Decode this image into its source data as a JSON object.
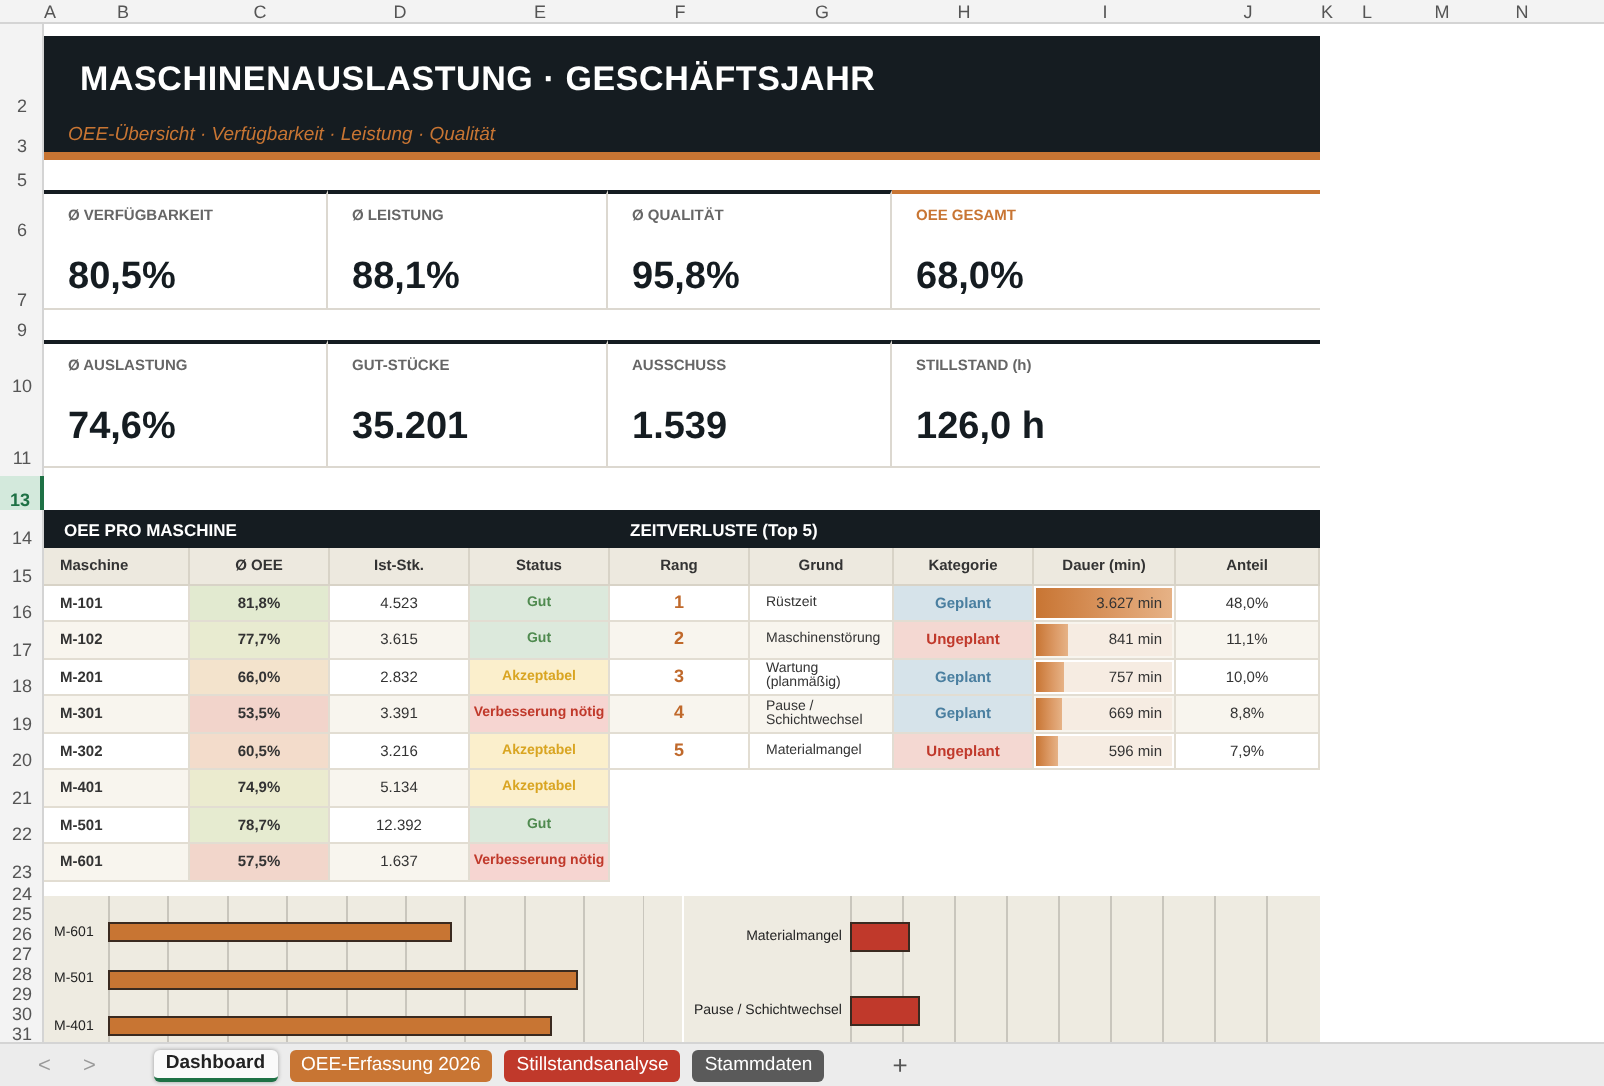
{
  "column_headers": [
    "A",
    "B",
    "C",
    "D",
    "E",
    "F",
    "G",
    "H",
    "I",
    "J",
    "K",
    "L",
    "M",
    "N"
  ],
  "row_headers": [
    {
      "label": "2",
      "selected": false
    },
    {
      "label": "3",
      "selected": false
    },
    {
      "label": "5",
      "selected": false
    },
    {
      "label": "6",
      "selected": false
    },
    {
      "label": "7",
      "selected": false
    },
    {
      "label": "9",
      "selected": false
    },
    {
      "label": "10",
      "selected": false
    },
    {
      "label": "11",
      "selected": false
    },
    {
      "label": "13",
      "selected": true
    },
    {
      "label": "14",
      "selected": false
    },
    {
      "label": "15",
      "selected": false
    },
    {
      "label": "16",
      "selected": false
    },
    {
      "label": "17",
      "selected": false
    },
    {
      "label": "18",
      "selected": false
    },
    {
      "label": "19",
      "selected": false
    },
    {
      "label": "20",
      "selected": false
    },
    {
      "label": "21",
      "selected": false
    },
    {
      "label": "22",
      "selected": false
    },
    {
      "label": "23",
      "selected": false
    },
    {
      "label": "24",
      "selected": false
    },
    {
      "label": "25",
      "selected": false
    },
    {
      "label": "26",
      "selected": false
    },
    {
      "label": "27",
      "selected": false
    },
    {
      "label": "28",
      "selected": false
    },
    {
      "label": "29",
      "selected": false
    },
    {
      "label": "30",
      "selected": false
    },
    {
      "label": "31",
      "selected": false
    }
  ],
  "header": {
    "title": "MASCHINENAUSLASTUNG · GESCHÄFTSJAHR",
    "subtitle": "OEE-Übersicht · Verfügbarkeit · Leistung · Qualität"
  },
  "kpi_rows": [
    [
      {
        "label": "Ø VERFÜGBARKEIT",
        "value": "80,5%",
        "highlight": false
      },
      {
        "label": "Ø LEISTUNG",
        "value": "88,1%",
        "highlight": false
      },
      {
        "label": "Ø QUALITÄT",
        "value": "95,8%",
        "highlight": false
      },
      {
        "label": "OEE GESAMT",
        "value": "68,0%",
        "highlight": true
      }
    ],
    [
      {
        "label": "Ø AUSLASTUNG",
        "value": "74,6%",
        "highlight": false
      },
      {
        "label": "GUT-STÜCKE",
        "value": "35.201",
        "highlight": false
      },
      {
        "label": "AUSSCHUSS",
        "value": "1.539",
        "highlight": false
      },
      {
        "label": "STILLSTAND (h)",
        "value": "126,0 h",
        "highlight": false
      }
    ]
  ],
  "section_header": {
    "left": "OEE PRO MASCHINE",
    "right": "ZEITVERLUSTE (Top 5)"
  },
  "machine_table": {
    "columns": [
      "Maschine",
      "Ø OEE",
      "Ist-Stk.",
      "Status"
    ],
    "rows": [
      {
        "machine": "M-101",
        "oee": "81,8%",
        "color": "#e2ead0",
        "units": "4.523",
        "status": {
          "text": "Gut",
          "kind": "good"
        }
      },
      {
        "machine": "M-102",
        "oee": "77,7%",
        "color": "#e8ebd0",
        "units": "3.615",
        "status": {
          "text": "Gut",
          "kind": "good"
        }
      },
      {
        "machine": "M-201",
        "oee": "66,0%",
        "color": "#f3e3cc",
        "units": "2.832",
        "status": {
          "text": "Akzeptabel",
          "kind": "acceptable"
        }
      },
      {
        "machine": "M-301",
        "oee": "53,5%",
        "color": "#f2d4cb",
        "units": "3.391",
        "status": {
          "text": "Verbesserung nötig",
          "kind": "improve"
        }
      },
      {
        "machine": "M-302",
        "oee": "60,5%",
        "color": "#f3dccb",
        "units": "3.216",
        "status": {
          "text": "Akzeptabel",
          "kind": "acceptable"
        }
      },
      {
        "machine": "M-401",
        "oee": "74,9%",
        "color": "#ebebcf",
        "units": "5.134",
        "status": {
          "text": "Akzeptabel",
          "kind": "acceptable"
        }
      },
      {
        "machine": "M-501",
        "oee": "78,7%",
        "color": "#e6ebd0",
        "units": "12.392",
        "status": {
          "text": "Gut",
          "kind": "good"
        }
      },
      {
        "machine": "M-601",
        "oee": "57,5%",
        "color": "#f2d6cb",
        "units": "1.637",
        "status": {
          "text": "Verbesserung nötig",
          "kind": "improve"
        }
      }
    ]
  },
  "losses_table": {
    "columns": [
      "Rang",
      "Grund",
      "Kategorie",
      "Dauer (min)",
      "Anteil"
    ],
    "rows": [
      {
        "rank": "1",
        "reason": "Rüstzeit",
        "category": {
          "text": "Geplant",
          "kind": "planned"
        },
        "duration": "3.627 min",
        "level": 1,
        "share": "48,0%"
      },
      {
        "rank": "2",
        "reason": "Maschinenstörung",
        "category": {
          "text": "Ungeplant",
          "kind": "unplanned"
        },
        "duration": "841 min",
        "level": 0.232,
        "share": "11,1%"
      },
      {
        "rank": "3",
        "reason": "Wartung (planmäßig)",
        "category": {
          "text": "Geplant",
          "kind": "planned"
        },
        "duration": "757 min",
        "level": 0.209,
        "share": "10,0%"
      },
      {
        "rank": "4",
        "reason": "Pause / Schichtwechsel",
        "category": {
          "text": "Geplant",
          "kind": "planned"
        },
        "duration": "669 min",
        "level": 0.184,
        "share": "8,8%"
      },
      {
        "rank": "5",
        "reason": "Materialmangel",
        "category": {
          "text": "Ungeplant",
          "kind": "unplanned"
        },
        "duration": "596 min",
        "level": 0.164,
        "share": "7,9%"
      }
    ]
  },
  "oee_chart": {
    "bars": [
      {
        "label": "M-601",
        "level": 0.64
      },
      {
        "label": "M-501",
        "level": 0.875
      },
      {
        "label": "M-401",
        "level": 0.83
      }
    ]
  },
  "loss_chart": {
    "bars": [
      {
        "label": "Materialmangel",
        "level": 0.13
      },
      {
        "label": "Pause / Schichtwechsel",
        "level": 0.15
      }
    ]
  },
  "sheet_nav": [
    "<",
    ">"
  ],
  "sheet_tabs": [
    {
      "label": "Dashboard",
      "selected": true
    },
    {
      "label": "OEE-Erfassung 2026",
      "selected": false,
      "color": "#c87533"
    },
    {
      "label": "Stillstandsanalyse",
      "selected": false,
      "color": "#c0392b"
    },
    {
      "label": "Stammdaten",
      "selected": false,
      "color": "#5a5a5a"
    }
  ],
  "new_sheet": "+"
}
